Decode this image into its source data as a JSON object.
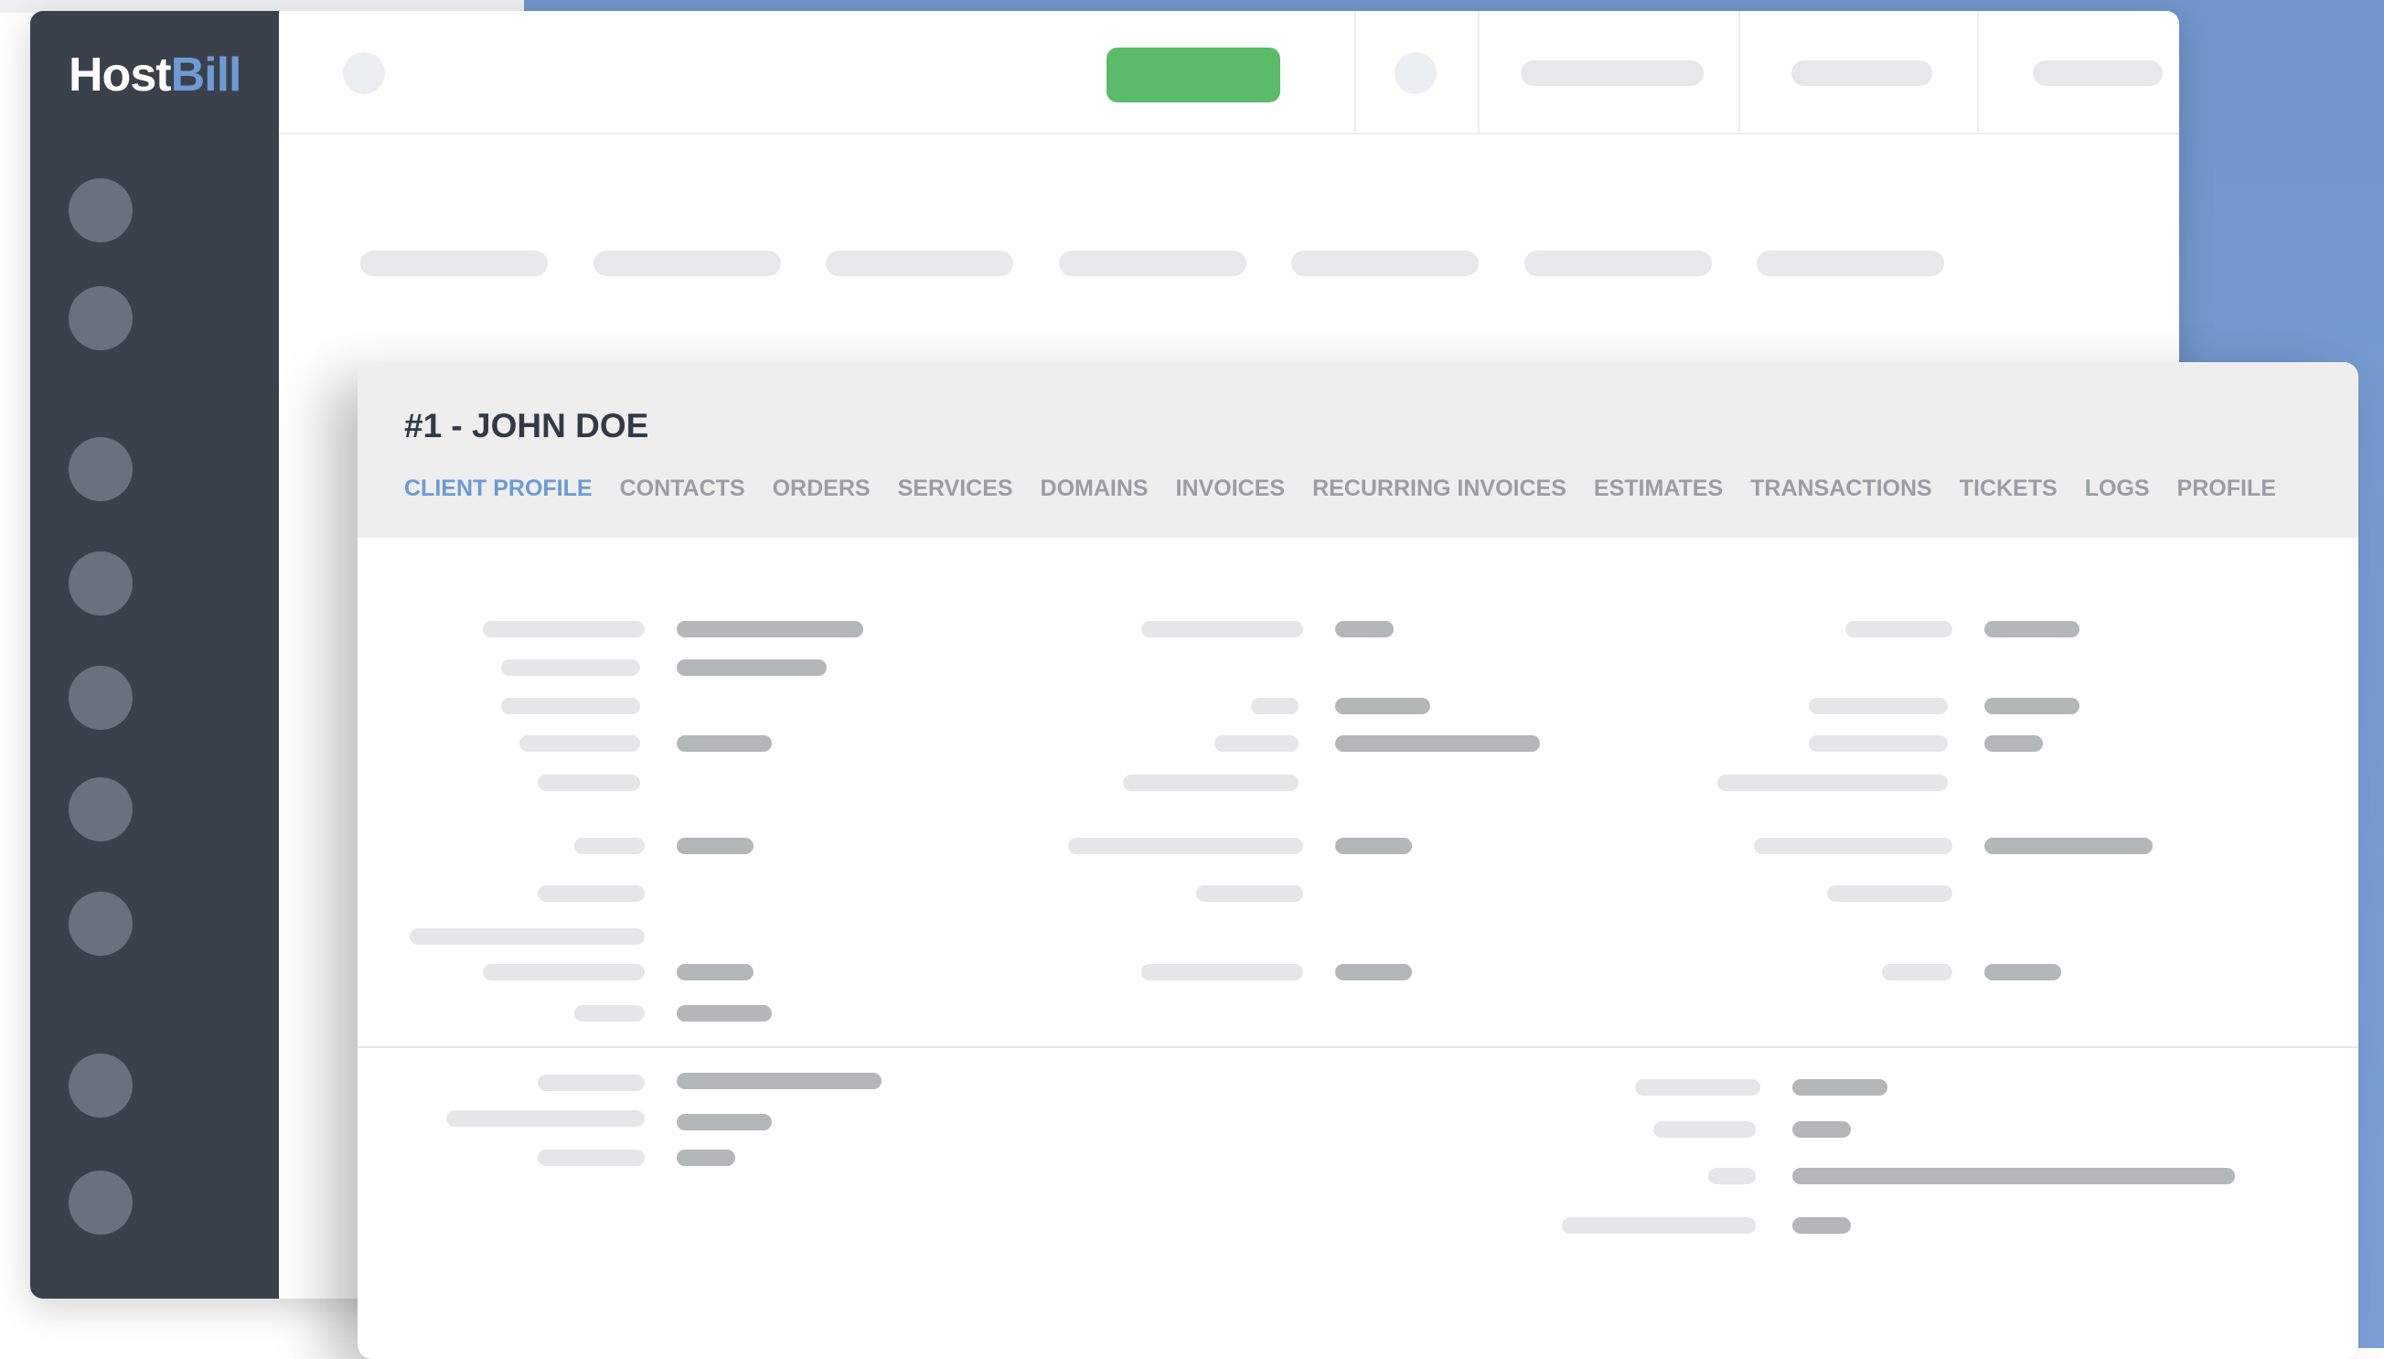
{
  "app": {
    "logo_part1": "Host",
    "logo_part2": "Bill"
  },
  "client": {
    "title": "#1 - JOHN DOE"
  },
  "tabs": [
    {
      "label": "CLIENT PROFILE",
      "active": true
    },
    {
      "label": "CONTACTS"
    },
    {
      "label": "ORDERS"
    },
    {
      "label": "SERVICES"
    },
    {
      "label": "DOMAINS"
    },
    {
      "label": "INVOICES"
    },
    {
      "label": "RECURRING INVOICES"
    },
    {
      "label": "ESTIMATES"
    },
    {
      "label": "TRANSACTIONS"
    },
    {
      "label": "TICKETS"
    },
    {
      "label": "LOGS"
    },
    {
      "label": "PROFILE"
    }
  ],
  "colors": {
    "accent": "#6b9ad7",
    "sidebar": "#3b414b",
    "primary_button": "#5bbb6a",
    "backdrop": "#7096cc"
  }
}
